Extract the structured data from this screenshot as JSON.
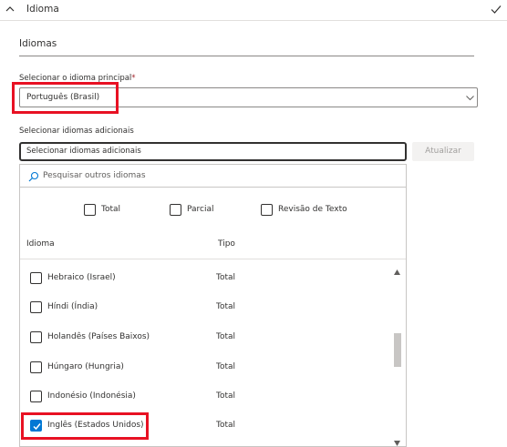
{
  "header": {
    "title": "Idioma",
    "icons": {
      "collapse": "chevron-up-icon",
      "status": "checkmark-icon"
    }
  },
  "section": {
    "title": "Idiomas"
  },
  "primary_language": {
    "label": "Selecionar o idioma principal",
    "required_mark": "*",
    "value": "Português (Brasil)",
    "icon": "chevron-down-icon"
  },
  "additional_languages": {
    "label": "Selecionar idiomas adicionais",
    "value": "Selecionar idiomas adicionais",
    "update_button": "Atualizar",
    "search_placeholder": "Pesquisar outros idiomas",
    "filters": [
      {
        "label": "Total",
        "checked": false
      },
      {
        "label": "Parcial",
        "checked": false
      },
      {
        "label": "Revisão de Texto",
        "checked": false
      }
    ],
    "columns": {
      "language": "Idioma",
      "type": "Tipo"
    },
    "rows": [
      {
        "language": "Hebraico (Israel)",
        "type": "Total",
        "checked": false
      },
      {
        "language": "Híndi (Índia)",
        "type": "Total",
        "checked": false
      },
      {
        "language": "Holandês (Países Baixos)",
        "type": "Total",
        "checked": false
      },
      {
        "language": "Húngaro (Hungria)",
        "type": "Total",
        "checked": false
      },
      {
        "language": "Indonésio (Indonésia)",
        "type": "Total",
        "checked": false
      },
      {
        "language": "Inglês (Estados Unidos)",
        "type": "Total",
        "checked": true
      }
    ]
  },
  "colors": {
    "accent": "#0078d4",
    "highlight": "#e81123",
    "required": "#a4262c"
  }
}
